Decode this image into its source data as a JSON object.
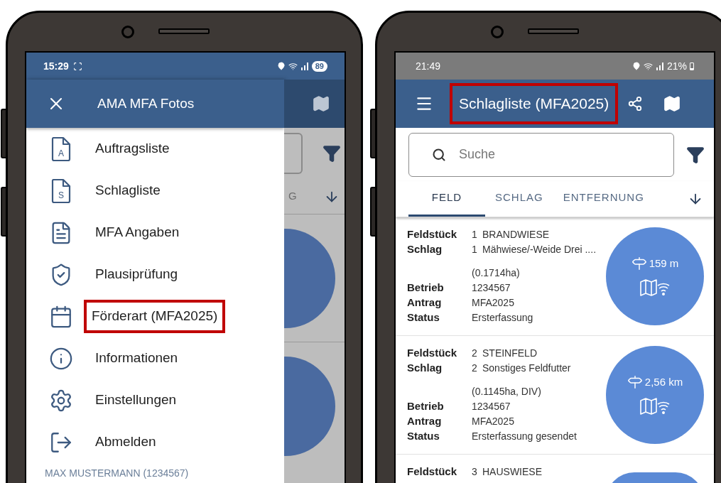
{
  "left_phone": {
    "status_bar": {
      "time": "15:29",
      "battery": "89"
    },
    "drawer": {
      "title": "AMA MFA Fotos",
      "items": [
        {
          "label": "Auftragsliste",
          "kind": "file-letter",
          "icon_letter": "A",
          "highlighted": false
        },
        {
          "label": "Schlagliste",
          "kind": "file-letter",
          "icon_letter": "S",
          "highlighted": false
        },
        {
          "label": "MFA Angaben",
          "kind": "file-lines",
          "highlighted": false
        },
        {
          "label": "Plausiprüfung",
          "kind": "shield",
          "highlighted": false
        },
        {
          "label": "Förderart (MFA2025)",
          "kind": "calendar",
          "highlighted": true
        },
        {
          "label": "Informationen",
          "kind": "info",
          "highlighted": false
        },
        {
          "label": "Einstellungen",
          "kind": "gear",
          "highlighted": false
        },
        {
          "label": "Abmelden",
          "kind": "logout",
          "highlighted": false
        }
      ],
      "footer": "MAX MUSTERMANN (1234567)"
    },
    "background_screen": {
      "tab_fragment": "G"
    }
  },
  "right_phone": {
    "status_bar": {
      "time": "21:49",
      "battery": "21%"
    },
    "app_bar": {
      "title": "Schlagliste (MFA2025)",
      "highlighted": true
    },
    "search": {
      "placeholder": "Suche"
    },
    "tabs": [
      {
        "label": "FELD",
        "selected": true
      },
      {
        "label": "SCHLAG",
        "selected": false
      },
      {
        "label": "ENTFERNUNG",
        "selected": false
      }
    ],
    "cards": [
      {
        "distance": "159 m",
        "fields": [
          {
            "label": "Feldstück",
            "number": "1",
            "value": "BRANDWIESE"
          },
          {
            "label": "Schlag",
            "number": "1",
            "value": "Mähwiese/-Weide Drei ....",
            "note": "(0.1714ha)"
          },
          {
            "label": "Betrieb",
            "value": "1234567"
          },
          {
            "label": "Antrag",
            "value": "MFA2025"
          },
          {
            "label": "Status",
            "value": "Ersterfassung"
          }
        ]
      },
      {
        "distance": "2,56 km",
        "fields": [
          {
            "label": "Feldstück",
            "number": "2",
            "value": "STEINFELD"
          },
          {
            "label": "Schlag",
            "number": "2",
            "value": "Sonstiges Feldfutter",
            "note": "(0.1145ha, DIV)"
          },
          {
            "label": "Betrieb",
            "value": "1234567"
          },
          {
            "label": "Antrag",
            "value": "MFA2025"
          },
          {
            "label": "Status",
            "value": "Ersterfassung gesendet"
          }
        ]
      },
      {
        "fields": [
          {
            "label": "Feldstück",
            "number": "3",
            "value": "HAUSWIESE"
          }
        ]
      }
    ]
  }
}
